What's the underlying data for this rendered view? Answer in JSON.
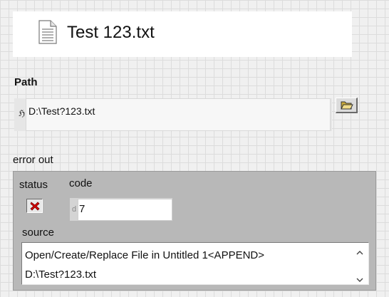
{
  "file": {
    "title": "Test 123.txt",
    "icon": "document-icon"
  },
  "path": {
    "label": "Path",
    "glyph": "ℌ",
    "value": "D:\\Test?123.txt",
    "browse_icon": "folder-open-icon"
  },
  "error_out": {
    "label": "error out",
    "status_label": "status",
    "status_icon": "red-x-icon",
    "code_label": "code",
    "code_radix": "d",
    "code_value": "7",
    "source_label": "source",
    "source_line1": "Open/Create/Replace File in Untitled 1<APPEND>",
    "source_line2": "D:\\Test?123.txt",
    "scroll_up": "˄",
    "scroll_down": "˅"
  },
  "colors": {
    "status_error": "#d40000",
    "cluster_bg": "#b8b8b8",
    "folder": "#e8d27a"
  }
}
